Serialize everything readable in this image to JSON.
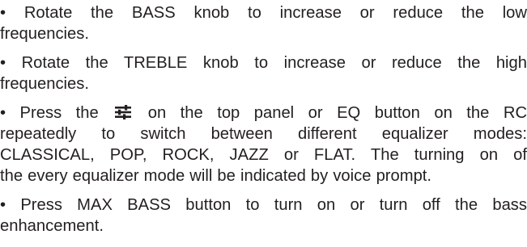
{
  "bullet": "•",
  "paragraphs": [
    {
      "lines": [
        "• Rotate the BASS knob to increase or reduce the low",
        "frequencies."
      ]
    },
    {
      "lines": [
        "• Rotate the TREBLE knob to increase or reduce the high",
        "frequencies."
      ]
    },
    {
      "line1_before_icon": "• Press the",
      "line1_after_icon": "on the top panel or EQ button on the RC",
      "icon": "equalizer-sliders-icon",
      "lines": [
        "repeatedly to switch between different equalizer modes:",
        "CLASSICAL, POP, ROCK, JAZZ or FLAT. The turning on of",
        "the every equalizer mode will be indicated by voice prompt."
      ]
    },
    {
      "lines": [
        "• Press MAX BASS button to turn on or turn off the bass",
        "enhancement."
      ]
    }
  ]
}
